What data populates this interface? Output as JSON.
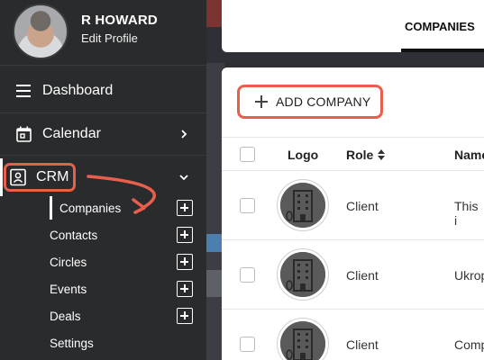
{
  "profile": {
    "name": "R HOWARD",
    "edit_label": "Edit Profile"
  },
  "sidebar": {
    "items": [
      {
        "label": "Dashboard",
        "icon": "menu-icon"
      },
      {
        "label": "Calendar",
        "icon": "calendar-icon"
      },
      {
        "label": "CRM",
        "icon": "contact-card-icon"
      }
    ],
    "crm_subitems": [
      {
        "label": "Companies"
      },
      {
        "label": "Contacts"
      },
      {
        "label": "Circles"
      },
      {
        "label": "Events"
      },
      {
        "label": "Deals"
      },
      {
        "label": "Settings"
      }
    ]
  },
  "tabs": {
    "active": "COMPANIES"
  },
  "toolbar": {
    "add_label": "ADD COMPANY"
  },
  "table": {
    "columns": [
      "Logo",
      "Role",
      "Name"
    ],
    "rows": [
      {
        "role": "Client",
        "name": "This i"
      },
      {
        "role": "Client",
        "name": "Ukrop"
      },
      {
        "role": "Client",
        "name": "Comp"
      }
    ]
  },
  "colors": {
    "sidebar": "#2a2b2d",
    "highlight": "#e8604c",
    "text_on_dark": "#ffffff"
  }
}
